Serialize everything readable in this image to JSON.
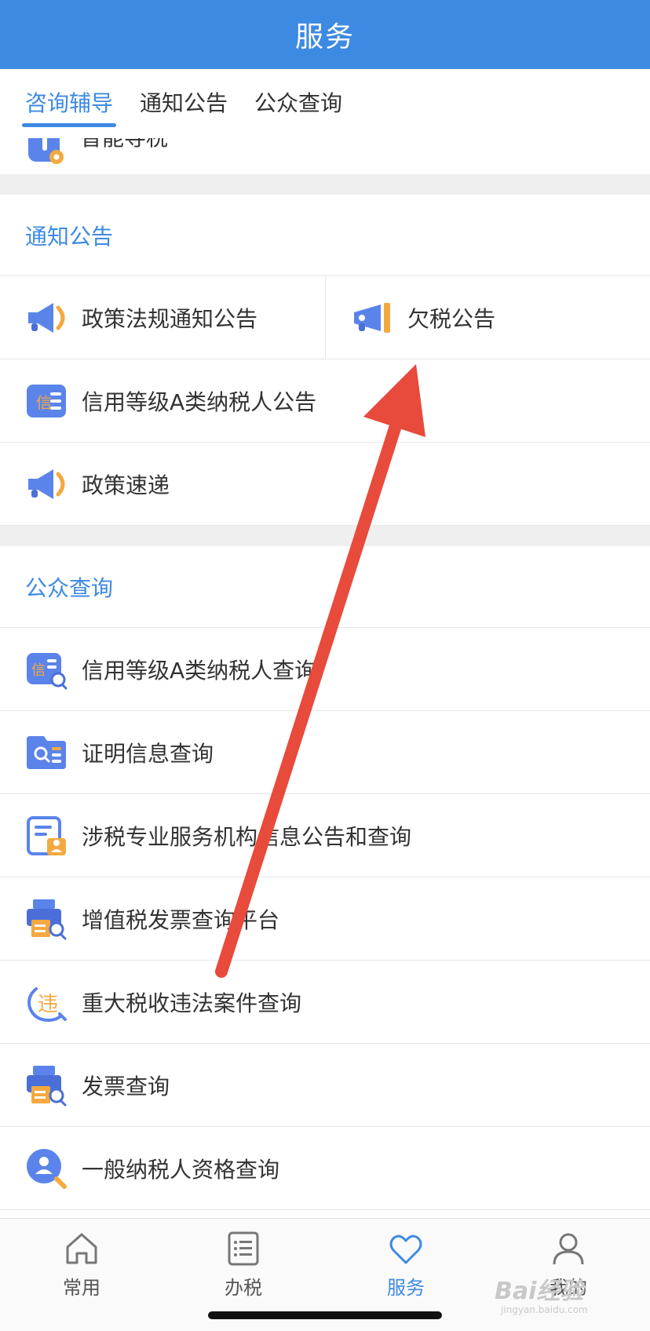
{
  "header": {
    "title": "服务"
  },
  "tabs": [
    {
      "label": "咨询辅导",
      "active": true
    },
    {
      "label": "通知公告",
      "active": false
    },
    {
      "label": "公众查询",
      "active": false
    }
  ],
  "partial_row": {
    "label": "智能导税",
    "icon": "smart-guide-icon"
  },
  "notice_section": {
    "title": "通知公告",
    "split_row": [
      {
        "label": "政策法规通知公告",
        "icon": "megaphone-icon"
      },
      {
        "label": "欠税公告",
        "icon": "megaphone-icon"
      }
    ],
    "items": [
      {
        "label": "信用等级A类纳税人公告",
        "icon": "credit-list-icon"
      },
      {
        "label": "政策速递",
        "icon": "megaphone-icon"
      }
    ]
  },
  "query_section": {
    "title": "公众查询",
    "items": [
      {
        "label": "信用等级A类纳税人查询",
        "icon": "credit-search-icon"
      },
      {
        "label": "证明信息查询",
        "icon": "certificate-search-icon"
      },
      {
        "label": "涉税专业服务机构信息公告和查询",
        "icon": "agency-document-icon"
      },
      {
        "label": "增值税发票查询平台",
        "icon": "invoice-printer-icon"
      },
      {
        "label": "重大税收违法案件查询",
        "icon": "violation-search-icon"
      },
      {
        "label": "发票查询",
        "icon": "invoice-printer-icon"
      },
      {
        "label": "一般纳税人资格查询",
        "icon": "person-search-icon"
      }
    ]
  },
  "tabbar": [
    {
      "label": "常用",
      "icon": "home-icon",
      "active": false
    },
    {
      "label": "办税",
      "icon": "list-icon",
      "active": false
    },
    {
      "label": "服务",
      "icon": "heart-icon",
      "active": true
    },
    {
      "label": "我的",
      "icon": "user-icon",
      "active": false
    }
  ],
  "watermark": {
    "main": "Bai经验",
    "sub": "jingyan.baidu.com"
  },
  "colors": {
    "primary": "#3d8ae3",
    "arrow": "#e84a3c",
    "divider": "#efefef"
  }
}
